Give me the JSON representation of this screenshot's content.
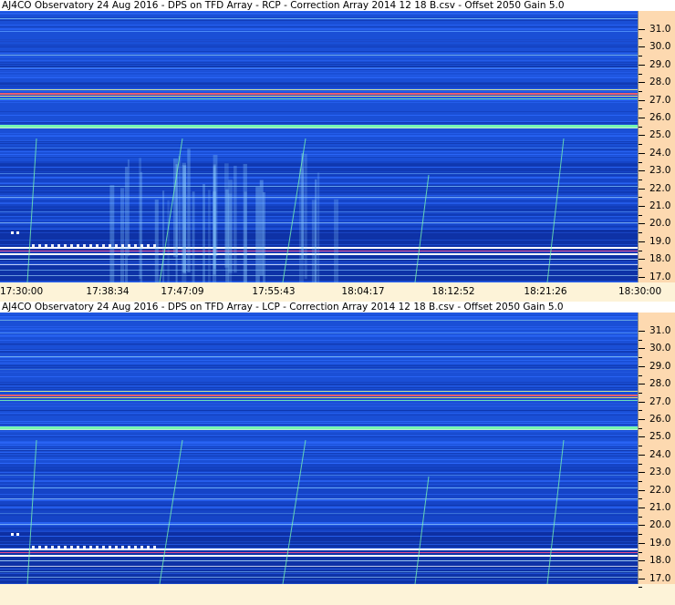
{
  "top_panel": {
    "title": "AJ4CO Observatory 24 Aug 2016  -  DPS on TFD Array  -  RCP  -  Correction Array 2014 12 18 B.csv  -  Offset 2050  Gain 5.0",
    "freq_labels": [
      "31.0",
      "30.0",
      "29.0",
      "28.0",
      "27.0",
      "26.0",
      "25.0",
      "24.0",
      "23.0",
      "22.0",
      "21.0",
      "20.0",
      "19.0",
      "18.0",
      "17.0"
    ],
    "time_labels": [
      "17:30:00",
      "17:38:34",
      "17:47:09",
      "17:55:43",
      "18:04:17",
      "18:12:52",
      "18:21:26",
      "18:30:00"
    ]
  },
  "bottom_panel": {
    "title": "AJ4CO Observatory 24 Aug 2016  -  DPS on TFD Array  -  LCP  -  Correction Array 2014 12 18 B.csv  -  Offset 2050  Gain 5.0",
    "freq_labels": [
      "31.0",
      "30.0",
      "29.0",
      "28.0",
      "27.0",
      "26.0",
      "25.0",
      "24.0",
      "23.0",
      "22.0",
      "21.0",
      "20.0",
      "19.0",
      "18.0",
      "17.0"
    ]
  },
  "colors": {
    "background_blue": "#1a4fd6",
    "dark_band": "#0b2a9a",
    "bright_line": "#ffffff",
    "green_line": "#7dffb0",
    "axis_bg": "#fdd9b0",
    "page_bg": "#fdf3d8"
  }
}
